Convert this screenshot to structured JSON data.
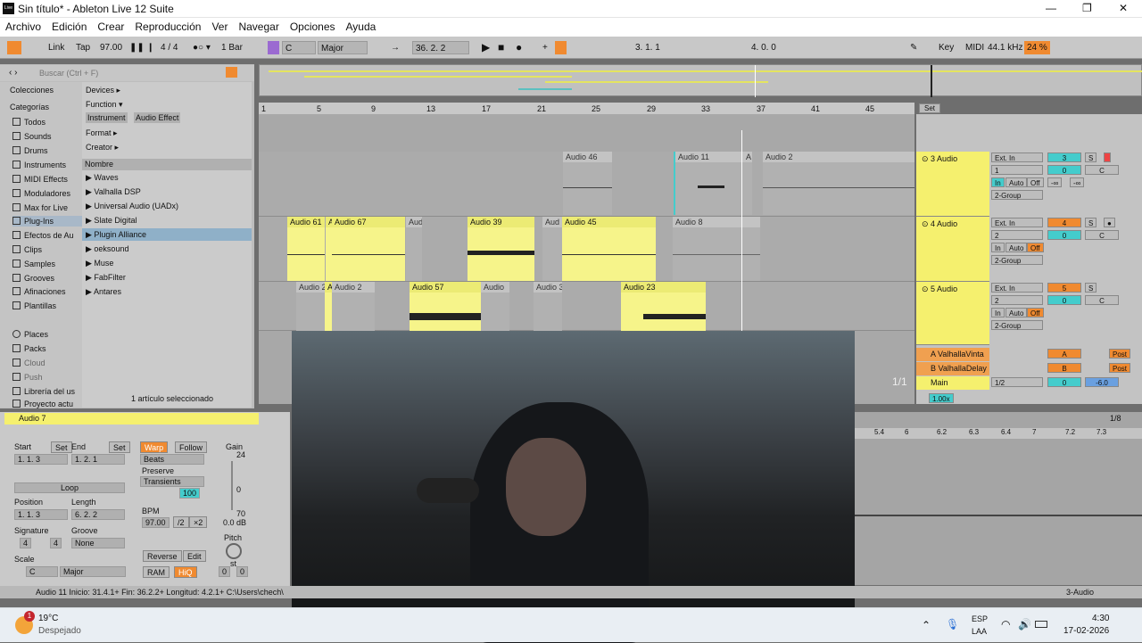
{
  "window": {
    "title": "Sin título* - Ableton Live 12 Suite",
    "app_badge": "Live"
  },
  "menu": [
    "Archivo",
    "Edición",
    "Crear",
    "Reproducción",
    "Ver",
    "Navegar",
    "Opciones",
    "Ayuda"
  ],
  "control": {
    "link": "Link",
    "tap": "Tap",
    "tempo": "97.00",
    "signature": "4 / 4",
    "quantize": "1 Bar",
    "key": "C",
    "scale": "Major",
    "position": "36.  2.  2",
    "loop_start": "3.  1.  1",
    "loop_len": "4.  0.  0",
    "key_btn": "Key",
    "midi_btn": "MIDI",
    "sample_rate": "44.1 kHz",
    "cpu": "24 %"
  },
  "browser": {
    "search_placeholder": "Buscar (Ctrl + F)",
    "collections_label": "Colecciones",
    "categories_label": "Categorías",
    "categories": [
      "Todos",
      "Sounds",
      "Drums",
      "Instruments",
      "MIDI Effects",
      "Moduladores",
      "Max for Live",
      "Plug-Ins",
      "Efectos de Au",
      "Clips",
      "Samples",
      "Grooves",
      "Afinaciones",
      "Plantillas"
    ],
    "places": [
      "Places",
      "Packs",
      "Cloud",
      "Push",
      "Librería del us",
      "Proyecto actu"
    ],
    "filters": [
      "Devices ▸",
      "Function ▾",
      "Format ▸",
      "Creator ▸"
    ],
    "tags": [
      "Instrument",
      "Audio Effect"
    ],
    "column_name": "Nombre",
    "items": [
      "Waves",
      "Valhalla DSP",
      "Universal Audio (UADx)",
      "Slate Digital",
      "Plugin Alliance",
      "oeksound",
      "Muse",
      "FabFilter",
      "Antares"
    ],
    "footer": "1 artículo seleccionado"
  },
  "ruler": [
    "1",
    "5",
    "9",
    "13",
    "17",
    "21",
    "25",
    "29",
    "33",
    "37",
    "41",
    "45"
  ],
  "clips": {
    "t2": [
      "Audio 46",
      "Audio 11",
      "A",
      "Audio 2"
    ],
    "t3": [
      "Audio 61",
      "A",
      "Audio 67",
      "Aud",
      "Audio 39",
      "Aud",
      "Audio 45",
      "Audio 8"
    ],
    "t4": [
      "Audio 2",
      "A",
      "Audio 2",
      "Audio 57",
      "Audio",
      "Audio 3",
      "Audio 23"
    ]
  },
  "tracks": [
    {
      "name": "3 Audio",
      "input": "Ext. In",
      "ch": "1",
      "num": "3",
      "vol": "0",
      "pan": "C",
      "group": "2-Group"
    },
    {
      "name": "4 Audio",
      "input": "Ext. In",
      "ch": "2",
      "num": "4",
      "vol": "0",
      "pan": "C",
      "group": "2-Group"
    },
    {
      "name": "5 Audio",
      "input": "Ext. In",
      "ch": "2",
      "num": "5",
      "vol": "0",
      "pan": "C",
      "group": "2-Group"
    }
  ],
  "returns": [
    {
      "name": "A ValhallaVinta",
      "letter": "A",
      "post": "Post"
    },
    {
      "name": "B ValhallaDelay",
      "letter": "B",
      "post": "Post"
    }
  ],
  "main": {
    "name": "Main",
    "out": "1/2",
    "vol": "0",
    "db": "-6.0",
    "ratio": "1/1",
    "zoom": "1.00x",
    "set": "Set"
  },
  "detail": {
    "title": "Audio 7",
    "start": "Start",
    "end": "End",
    "set": "Set",
    "start_val": "1.   1.   3",
    "end_val": "1.   2.   1",
    "loop": "Loop",
    "position": "Position",
    "length": "Length",
    "pos_val": "1.   1.   3",
    "len_val": "6.   2.   2",
    "signature": "Signature",
    "groove": "Groove",
    "sig_num": "4",
    "sig_den": "4",
    "groove_val": "None",
    "scale": "Scale",
    "scale_key": "C",
    "scale_mode": "Major",
    "warp": "Warp",
    "follow": "Follow",
    "beats": "Beats",
    "preserve": "Preserve",
    "transients": "Transients",
    "amount": "100",
    "bpm_label": "BPM",
    "bpm": "97.00",
    "half": "/2",
    "double": "×2",
    "reverse": "Reverse",
    "edit": "Edit",
    "ram": "RAM",
    "hiq": "HiQ",
    "gain": "Gain",
    "gain_top": "24",
    "gain_zero": "0",
    "gain_bottom": "70",
    "gain_db": "0.0 dB",
    "pitch": "Pitch",
    "pitch_unit": "st",
    "pitch_a": "0",
    "pitch_b": "0"
  },
  "clipview": {
    "ratio": "1/8",
    "marks": [
      "5.4",
      "6",
      "6.2",
      "6.3",
      "6.4",
      "7",
      "7.2",
      "7.3"
    ]
  },
  "status": {
    "text": "Audio 11  Inicio: 31.4.1+  Fin: 36.2.2+  Longitud: 4.2.1+  C:\\Users\\chech\\",
    "track": "3-Audio"
  },
  "taskbar": {
    "temp": "19°C",
    "weather": "Despejado",
    "lang": "ESP",
    "lang2": "LAA",
    "time": "4:30",
    "date": "17-02-2026",
    "badge": "1"
  }
}
